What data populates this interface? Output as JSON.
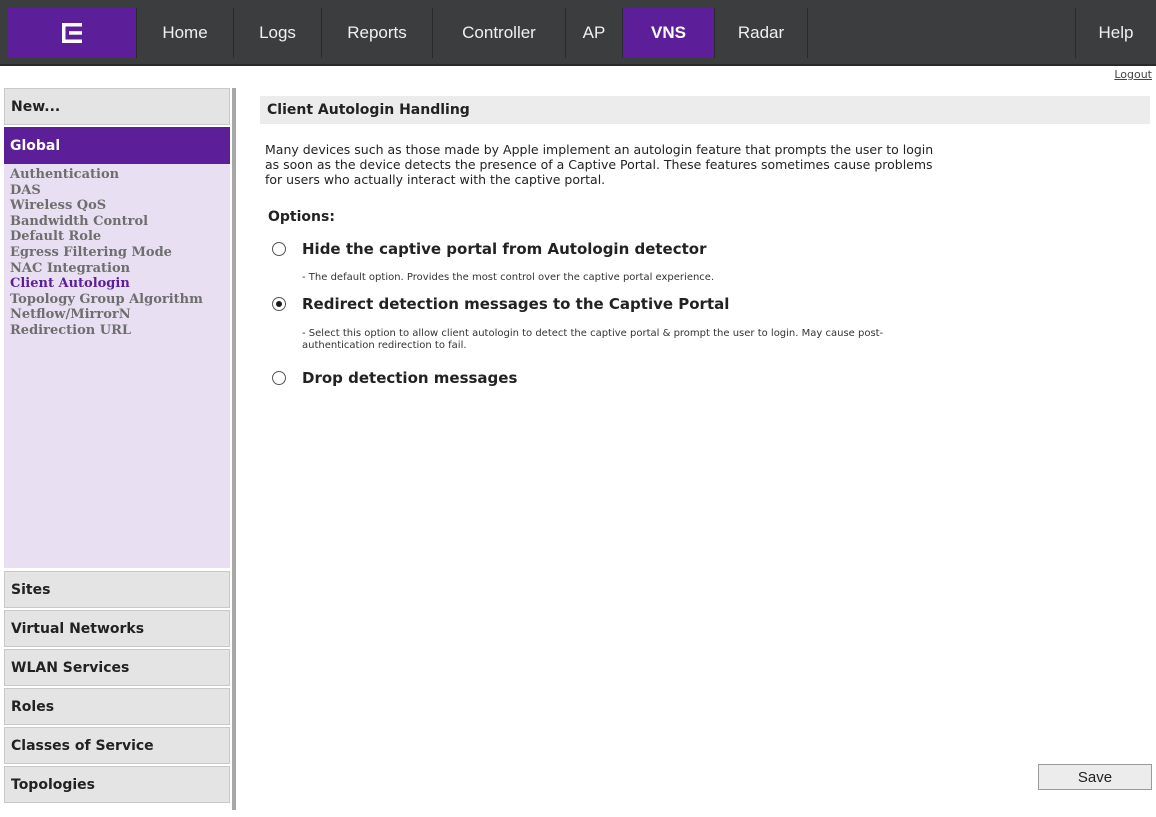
{
  "nav": {
    "items": [
      {
        "label": "Home",
        "active": false
      },
      {
        "label": "Logs",
        "active": false
      },
      {
        "label": "Reports",
        "active": false
      },
      {
        "label": "Controller",
        "active": false
      },
      {
        "label": "AP",
        "active": false
      },
      {
        "label": "VNS",
        "active": true
      },
      {
        "label": "Radar",
        "active": false
      }
    ],
    "help": "Help",
    "logout": "Logout"
  },
  "sidebar": {
    "new": "New...",
    "global": "Global",
    "global_items": [
      "Authentication",
      "DAS",
      "Wireless QoS",
      "Bandwidth Control",
      "Default Role",
      "Egress Filtering Mode",
      "NAC Integration",
      "Client Autologin",
      "Topology Group Algorithm",
      "Netflow/MirrorN",
      "Redirection URL"
    ],
    "current": "Client Autologin",
    "sections": [
      "Sites",
      "Virtual Networks",
      "WLAN Services",
      "Roles",
      "Classes of Service",
      "Topologies"
    ]
  },
  "main": {
    "title": "Client Autologin Handling",
    "description_lines": [
      "Many devices such as those made by Apple implement an autologin feature that prompts the user to login",
      "as soon as the device detects the presence of a Captive Portal. These features sometimes cause problems",
      "for users who actually interact with the captive portal."
    ],
    "options_label": "Options:",
    "options": [
      {
        "label": "Hide the captive portal from Autologin detector",
        "note_lines": [
          "- The default option. Provides the most control over the captive portal experience."
        ],
        "selected": false
      },
      {
        "label": "Redirect detection messages to the Captive Portal",
        "note_lines": [
          "- Select this option to allow client autologin to detect the captive portal & prompt the user to login. May cause post-",
          "authentication redirection to fail."
        ],
        "selected": true
      },
      {
        "label": "Drop detection messages",
        "note_lines": [],
        "selected": false
      }
    ],
    "save_label": "Save"
  },
  "colors": {
    "brand_purple": "#5c1f99",
    "topbar": "#3c3d3f",
    "sidebar_panel": "#e8e0f2"
  }
}
